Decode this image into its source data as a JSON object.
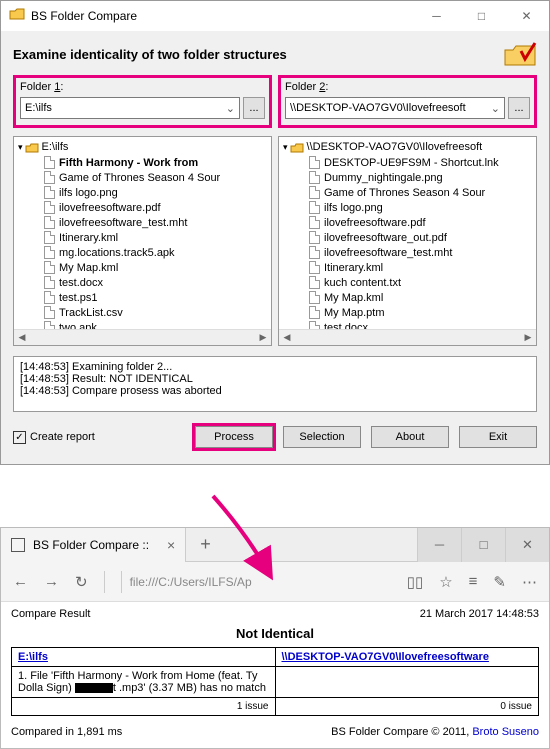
{
  "app": {
    "title": "BS Folder Compare",
    "heading": "Examine identicality of two folder structures"
  },
  "folder1": {
    "label_pre": "Folder ",
    "label_key": "1",
    "label_post": ":",
    "path": "E:\\ilfs",
    "root": "E:\\ilfs",
    "items": [
      {
        "name": "Fifth Harmony - Work from ",
        "bold": true
      },
      {
        "name": "Game of Thrones Season 4 Sour"
      },
      {
        "name": "ilfs logo.png"
      },
      {
        "name": "ilovefreesoftware.pdf"
      },
      {
        "name": "ilovefreesoftware_test.mht"
      },
      {
        "name": "Itinerary.kml"
      },
      {
        "name": "mg.locations.track5.apk"
      },
      {
        "name": "My Map.kml"
      },
      {
        "name": "test.docx"
      },
      {
        "name": "test.ps1"
      },
      {
        "name": "TrackList.csv"
      },
      {
        "name": "two.apk"
      }
    ]
  },
  "folder2": {
    "label_pre": "Folder ",
    "label_key": "2",
    "label_post": ":",
    "path": "\\\\DESKTOP-VAO7GV0\\Ilovefreesoft",
    "root": "\\\\DESKTOP-VAO7GV0\\Ilovefreesoft",
    "items": [
      {
        "name": "DESKTOP-UE9FS9M - Shortcut.lnk"
      },
      {
        "name": "Dummy_nightingale.png"
      },
      {
        "name": "Game of Thrones Season 4 Sour"
      },
      {
        "name": "ilfs logo.png"
      },
      {
        "name": "ilovefreesoftware.pdf"
      },
      {
        "name": "ilovefreesoftware_out.pdf"
      },
      {
        "name": "ilovefreesoftware_test.mht"
      },
      {
        "name": "Itinerary.kml"
      },
      {
        "name": "kuch content.txt"
      },
      {
        "name": "My Map.kml"
      },
      {
        "name": "My Map.ptm"
      },
      {
        "name": "test.docx"
      }
    ]
  },
  "log": {
    "l1": "[14:48:53] Examining folder 2...",
    "l2": "[14:48:53] Result: NOT IDENTICAL",
    "l3": "[14:48:53] Compare prosess was aborted"
  },
  "buttons": {
    "create_report": "Create report",
    "process": "Process",
    "selection": "Selection",
    "about": "About",
    "exit": "Exit"
  },
  "browser": {
    "tab_title": "BS Folder Compare :: No",
    "url": "file:///C:/Users/ILFS/Ap"
  },
  "report": {
    "head_left": "Compare Result",
    "head_right": "21 March 2017 14:48:53",
    "verdict": "Not Identical",
    "col1": "E:\\ilfs",
    "col2": "\\\\DESKTOP-VAO7GV0\\Ilovefreesoftware",
    "item_pre": "1.  File 'Fifth Harmony - Work from Home (feat. Ty Dolla Sign) ",
    "item_post": "t .mp3' (3.37 MB) has no match",
    "issue1": "1 issue",
    "issue0": "0 issue",
    "foot_left": "Compared in 1,891 ms",
    "foot_right_pre": "BS Folder Compare © 2011, ",
    "foot_right_author": "Broto Suseno"
  }
}
